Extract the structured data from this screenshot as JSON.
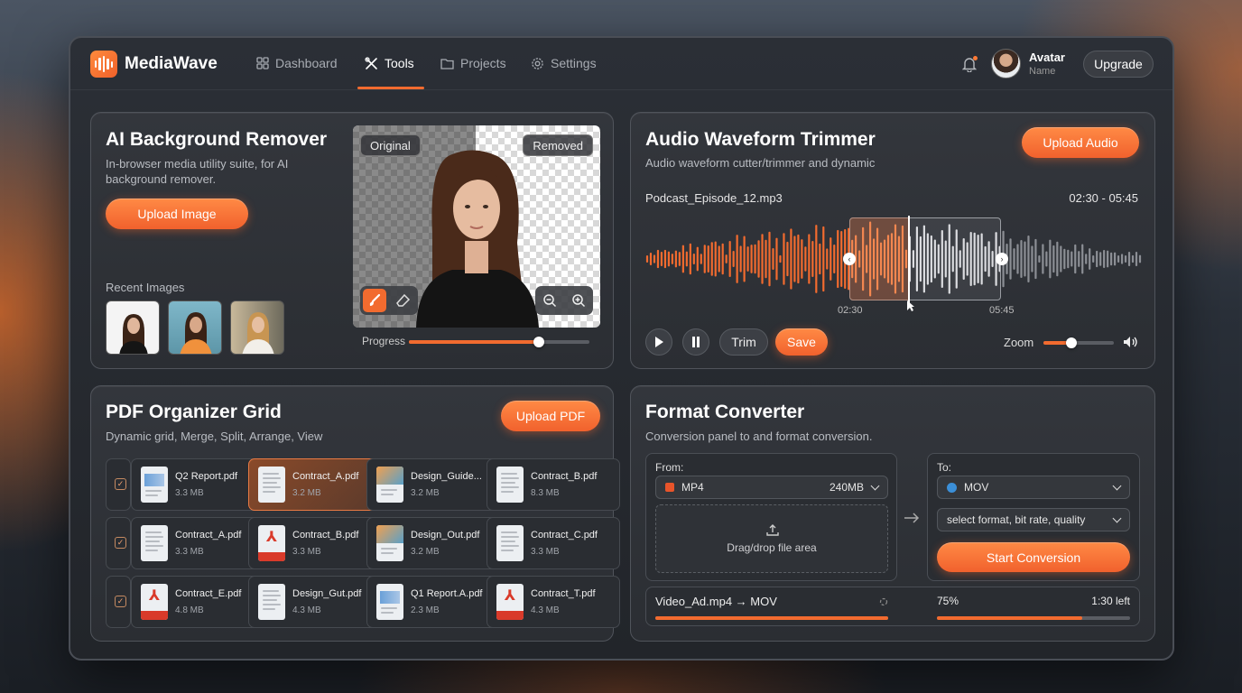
{
  "app": {
    "name": "MediaWave"
  },
  "nav": {
    "items": [
      {
        "label": "Dashboard"
      },
      {
        "label": "Tools"
      },
      {
        "label": "Projects"
      },
      {
        "label": "Settings"
      }
    ],
    "active": "Tools",
    "avatar_title": "Avatar",
    "avatar_sub": "Name",
    "upgrade": "Upgrade"
  },
  "bg_remover": {
    "title": "AI Background Remover",
    "subtitle": "In-browser media utility suite, for AI background remover.",
    "upload": "Upload Image",
    "recent_label": "Recent Images",
    "label_original": "Original",
    "label_removed": "Removed",
    "progress_label": "Progress",
    "progress": 0.72
  },
  "audio": {
    "title": "Audio Waveform Trimmer",
    "subtitle": "Audio waveform cutter/trimmer and dynamic",
    "upload": "Upload Audio",
    "filename": "Podcast_Episode_12.mp3",
    "range": "02:30 - 05:45",
    "start_label": "02:30",
    "end_label": "05:45",
    "trim": "Trim",
    "save": "Save",
    "zoom_label": "Zoom",
    "zoom": 0.4
  },
  "pdf": {
    "title": "PDF Organizer Grid",
    "subtitle": "Dynamic grid, Merge, Split, Arrange, View",
    "upload": "Upload PDF",
    "rows": [
      [
        {
          "name": "Q2 Report.pdf",
          "size": "3.3 MB",
          "kind": "chart"
        },
        {
          "name": "Contract_A.pdf",
          "size": "3.2 MB",
          "kind": "doc",
          "selected": true
        },
        {
          "name": "Design_Guide...",
          "size": "3.2 MB",
          "kind": "design"
        },
        {
          "name": "Contract_B.pdf",
          "size": "8.3 MB",
          "kind": "doc"
        }
      ],
      [
        {
          "name": "Contract_A.pdf",
          "size": "3.3 MB",
          "kind": "doc"
        },
        {
          "name": "Contract_B.pdf",
          "size": "3.3 MB",
          "kind": "pdf"
        },
        {
          "name": "Design_Out.pdf",
          "size": "3.2 MB",
          "kind": "design"
        },
        {
          "name": "Contract_C.pdf",
          "size": "3.3 MB",
          "kind": "doc"
        }
      ],
      [
        {
          "name": "Contract_E.pdf",
          "size": "4.8 MB",
          "kind": "pdf"
        },
        {
          "name": "Design_Gut.pdf",
          "size": "4.3 MB",
          "kind": "doc"
        },
        {
          "name": "Q1 Report.A.pdf",
          "size": "2.3 MB",
          "kind": "chart"
        },
        {
          "name": "Contract_T.pdf",
          "size": "4.3 MB",
          "kind": "pdf"
        }
      ]
    ]
  },
  "converter": {
    "title": "Format Converter",
    "subtitle": "Conversion panel to and format conversion.",
    "from_label": "From:",
    "from_format": "MP4",
    "from_size": "240MB",
    "drop_label": "Drag/drop file area",
    "to_label": "To:",
    "to_format": "MOV",
    "options_placeholder": "select format, bit rate, quality",
    "start": "Start Conversion",
    "job": "Video_Ad.mp4 → MOV",
    "percent": "75%",
    "time_left": "1:30 left",
    "progress": 0.75
  },
  "colors": {
    "accent": "#f26b2f",
    "panel": "#2f3237"
  }
}
